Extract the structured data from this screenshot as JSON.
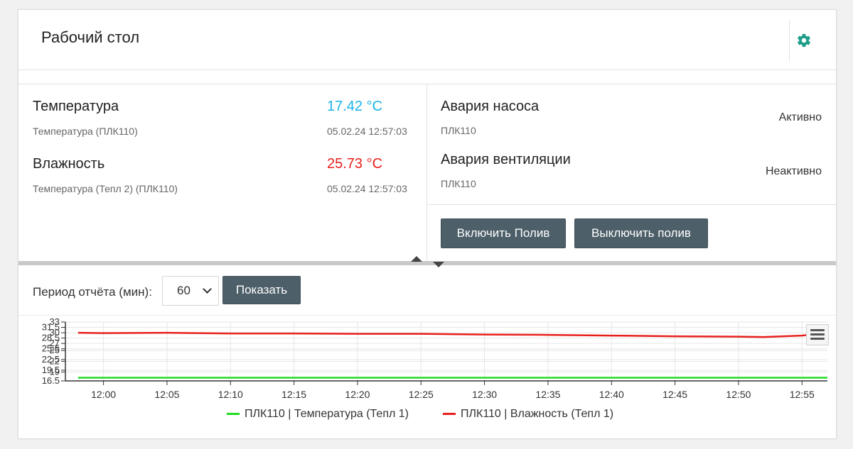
{
  "header": {
    "title": "Рабочий стол",
    "settings_icon": "gear-icon",
    "accent_color": "#1f9e8a"
  },
  "metrics": [
    {
      "name": "Температура",
      "subtitle": "Температура (ПЛК110)",
      "value": "17.42 °C",
      "timestamp": "05.02.24 12:57:03",
      "color": "#1ab4e8"
    },
    {
      "name": "Влажность",
      "subtitle": "Температура (Тепл 2) (ПЛК110)",
      "value": "25.73 °C",
      "timestamp": "05.02.24 12:57:03",
      "color": "#e8201c"
    }
  ],
  "alarms": [
    {
      "name": "Авария насоса",
      "source": "ПЛК110",
      "state": "Активно"
    },
    {
      "name": "Авария вентиляции",
      "source": "ПЛК110",
      "state": "Неактивно"
    }
  ],
  "controls": {
    "enable_label": "Включить Полив",
    "disable_label": "Выключить полив"
  },
  "report": {
    "period_label": "Период отчёта (мин):",
    "period_value": "60",
    "show_label": "Показать"
  },
  "chart_data": {
    "type": "line",
    "x_ticks": [
      "12:00",
      "12:05",
      "12:10",
      "12:15",
      "12:20",
      "12:25",
      "12:30",
      "12:35",
      "12:40",
      "12:45",
      "12:50",
      "12:55"
    ],
    "y_ticks": [
      16.5,
      19,
      19.5,
      22,
      22.5,
      25,
      25.5,
      27,
      28.5,
      30,
      31.5,
      33
    ],
    "ylim": [
      16.5,
      33
    ],
    "grid": true,
    "legend_position": "bottom",
    "series": [
      {
        "name": "ПЛК110 | Температура (Тепл 1)",
        "color": "#22dd22",
        "x": [
          "11:58",
          "12:00",
          "12:05",
          "12:10",
          "12:15",
          "12:20",
          "12:25",
          "12:30",
          "12:35",
          "12:40",
          "12:45",
          "12:50",
          "12:55",
          "12:57"
        ],
        "values": [
          17.4,
          17.4,
          17.4,
          17.4,
          17.4,
          17.4,
          17.4,
          17.4,
          17.4,
          17.4,
          17.4,
          17.4,
          17.4,
          17.4
        ]
      },
      {
        "name": "ПЛК110 | Влажность (Тепл 1)",
        "color": "#e8201c",
        "x": [
          "11:58",
          "12:00",
          "12:05",
          "12:10",
          "12:15",
          "12:20",
          "12:25",
          "12:30",
          "12:35",
          "12:40",
          "12:45",
          "12:50",
          "12:52",
          "12:55",
          "12:57"
        ],
        "values": [
          30.0,
          29.9,
          30.0,
          29.8,
          29.8,
          29.7,
          29.7,
          29.5,
          29.4,
          29.2,
          29.0,
          28.9,
          28.8,
          29.2,
          30.0
        ]
      }
    ]
  }
}
